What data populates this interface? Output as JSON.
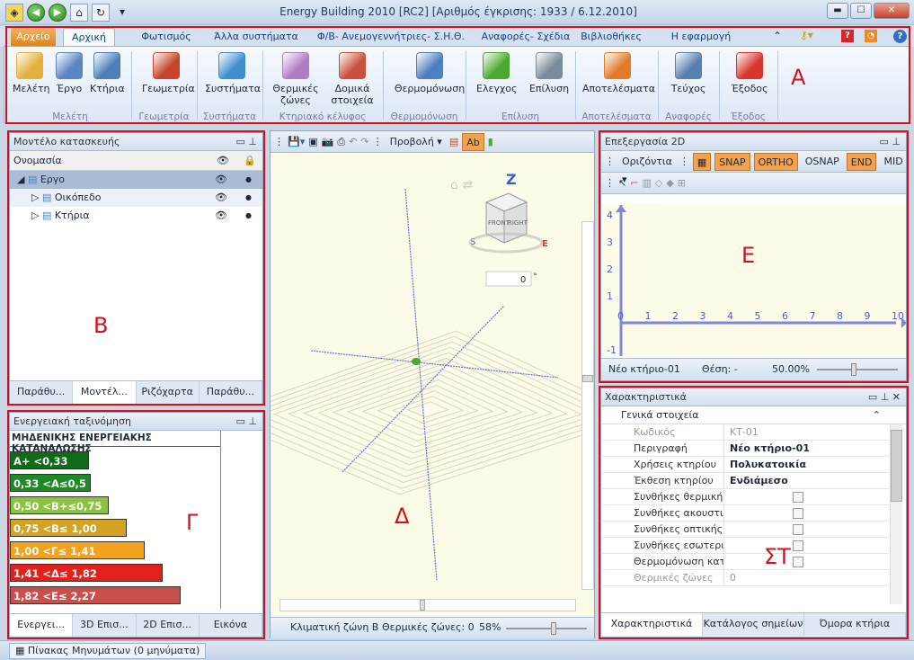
{
  "window": {
    "title": "Energy Building 2010 [RC2] [Αριθμός έγκρισης: 1933 / 6.12.2010]",
    "min": "▬",
    "max": "☐",
    "close": "✕"
  },
  "ribbon_tabs": [
    "Αρχείο",
    "Αρχική",
    "Φωτισμός",
    "Άλλα συστήματα",
    "Φ/Β- Ανεμογεννήτριες- Σ.Η.Θ.",
    "Αναφορές- Σχέδια",
    "Βιβλιοθήκες",
    "Η εφαρμογή"
  ],
  "ribbon": {
    "buttons": [
      {
        "label": "Μελέτη",
        "icon": "folder-icon",
        "color": "#e2b13c"
      },
      {
        "label": "Έργο",
        "icon": "project-icon",
        "color": "#5a86c2"
      },
      {
        "label": "Κτήρια",
        "icon": "buildings-icon",
        "color": "#4d7fb8"
      },
      {
        "label": "Γεωμετρία",
        "icon": "geometry-icon",
        "color": "#c5452a"
      },
      {
        "label": "Συστήματα",
        "icon": "systems-cube-icon",
        "color": "#3f8fd0"
      },
      {
        "label": "Θερμικές ζώνες",
        "icon": "thermal-zones-icon",
        "color": "#b07cc6"
      },
      {
        "label": "Δομικά στοιχεία",
        "icon": "building-elements-icon",
        "color": "#c9503a"
      },
      {
        "label": "Θερμομόνωση",
        "icon": "house-insulation-icon",
        "color": "#4e7fc0"
      },
      {
        "label": "Ελεγχος",
        "icon": "check-icon",
        "color": "#4aaa2e"
      },
      {
        "label": "Επίλυση",
        "icon": "calculator-icon",
        "color": "#7a8a9a"
      },
      {
        "label": "Αποτελέσματα",
        "icon": "pie-chart-icon",
        "color": "#e07b2a"
      },
      {
        "label": "Τεύχος",
        "icon": "document-icon",
        "color": "#5a7fae"
      },
      {
        "label": "Έξοδος",
        "icon": "exit-icon",
        "color": "#d9352a"
      }
    ],
    "groups": [
      "Μελέτη",
      "Γεωμετρία",
      "Συστήματα",
      "Κτηριακό κέλυφος",
      "Θερμομόνωση",
      "Επίλυση",
      "Αποτελέσματα",
      "Αναφορές",
      "Έξοδος"
    ]
  },
  "annotations": {
    "A": "Α",
    "B": "Β",
    "C": "Γ",
    "D": "Δ",
    "E": "Ε",
    "F": "ΣΤ"
  },
  "model_panel": {
    "title": "Μοντέλο κατασκευής",
    "column": "Ονομασία",
    "items": [
      {
        "label": "Εργο",
        "icon": "project-icon"
      },
      {
        "label": "Οικόπεδο",
        "icon": "plot-icon"
      },
      {
        "label": "Κτήρια",
        "icon": "buildings-icon"
      }
    ],
    "tabs": [
      "Παράθυ...",
      "Μοντέλ...",
      "Ριζόχαρτα",
      "Παράθυ..."
    ]
  },
  "energy_panel": {
    "title": "Ενεργειακή ταξινόμηση",
    "header": "ΜΗΔΕΝΙΚΗΣ ΕΝΕΡΓΕΙΑΚΗΣ ΚΑΤΑΝΑΛΩΣΗΣ",
    "bars": [
      {
        "label": "Α+ <0,33",
        "color": "#0e6b17"
      },
      {
        "label": "0,33 <Α≤0,5",
        "color": "#1f8a25"
      },
      {
        "label": "0,50 <Β+≤0,75",
        "color": "#8ac43e"
      },
      {
        "label": "0,75 <Β≤ 1,00",
        "color": "#d4a323"
      },
      {
        "label": "1,00 <Γ≤ 1,41",
        "color": "#f2a21c"
      },
      {
        "label": "1,41 <Δ≤ 1,82",
        "color": "#e3201b"
      },
      {
        "label": "1,82 <Ε≤ 2,27",
        "color": "#c9504a"
      }
    ],
    "tabs": [
      "Ενεργει...",
      "3D Επισ...",
      "2D Επισ...",
      "Εικόνα"
    ]
  },
  "view3d": {
    "toolbar_view": "Προβολή",
    "angle_value": "0",
    "angle_unit": "°",
    "status": [
      "Κλιματική ζώνη Β",
      "Θερμικές ζώνες: 0",
      "58%"
    ],
    "cube_labels": [
      "Z",
      "FRONT",
      "RIGHT",
      "E",
      "S"
    ]
  },
  "edit2d": {
    "title": "Επεξεργασία 2D",
    "mode": "Οριζόντια",
    "snaps": [
      "SNAP",
      "ORTHO",
      "OSNAP",
      "END",
      "MID"
    ],
    "x_ticks": [
      "0",
      "1",
      "2",
      "3",
      "4",
      "5",
      "6",
      "7",
      "8",
      "9",
      "10"
    ],
    "y_ticks": [
      "-1",
      "1",
      "2",
      "3",
      "4"
    ],
    "status": [
      "Νέο κτήριο-01",
      "Θέση: -",
      "50.00%"
    ]
  },
  "props": {
    "title": "Χαρακτηριστικά",
    "section": "Γενικά στοιχεία",
    "rows": [
      {
        "key": "Κωδικός",
        "value": "ΚΤ-01",
        "dim": true
      },
      {
        "key": "Περιγραφή",
        "value": "Νέο κτήριο-01"
      },
      {
        "key": "Χρήσεις κτηρίου",
        "value": "Πολυκατοικία"
      },
      {
        "key": "Έκθεση κτηρίου",
        "value": "Ενδιάμεσο"
      },
      {
        "key": "Συνθήκες θερμικής άνεσης",
        "value": ""
      },
      {
        "key": "Συνθήκες ακουστικής άνεσης",
        "value": ""
      },
      {
        "key": "Συνθήκες οπτικής άνεσης",
        "value": ""
      },
      {
        "key": "Συνθήκες εσωτερικού αέρα",
        "value": ""
      },
      {
        "key": "Θερμομόνωση κατακόρυφων",
        "value": ""
      },
      {
        "key": "Θερμικές ζώνες",
        "value": "0",
        "dim": true
      }
    ],
    "tabs": [
      "Χαρακτηριστικά",
      "Κατάλογος σημείων",
      "Όμορα κτήρια"
    ]
  },
  "statusbar": {
    "messages": "Πίνακας Μηνυμάτων (0 μηνύματα)"
  }
}
